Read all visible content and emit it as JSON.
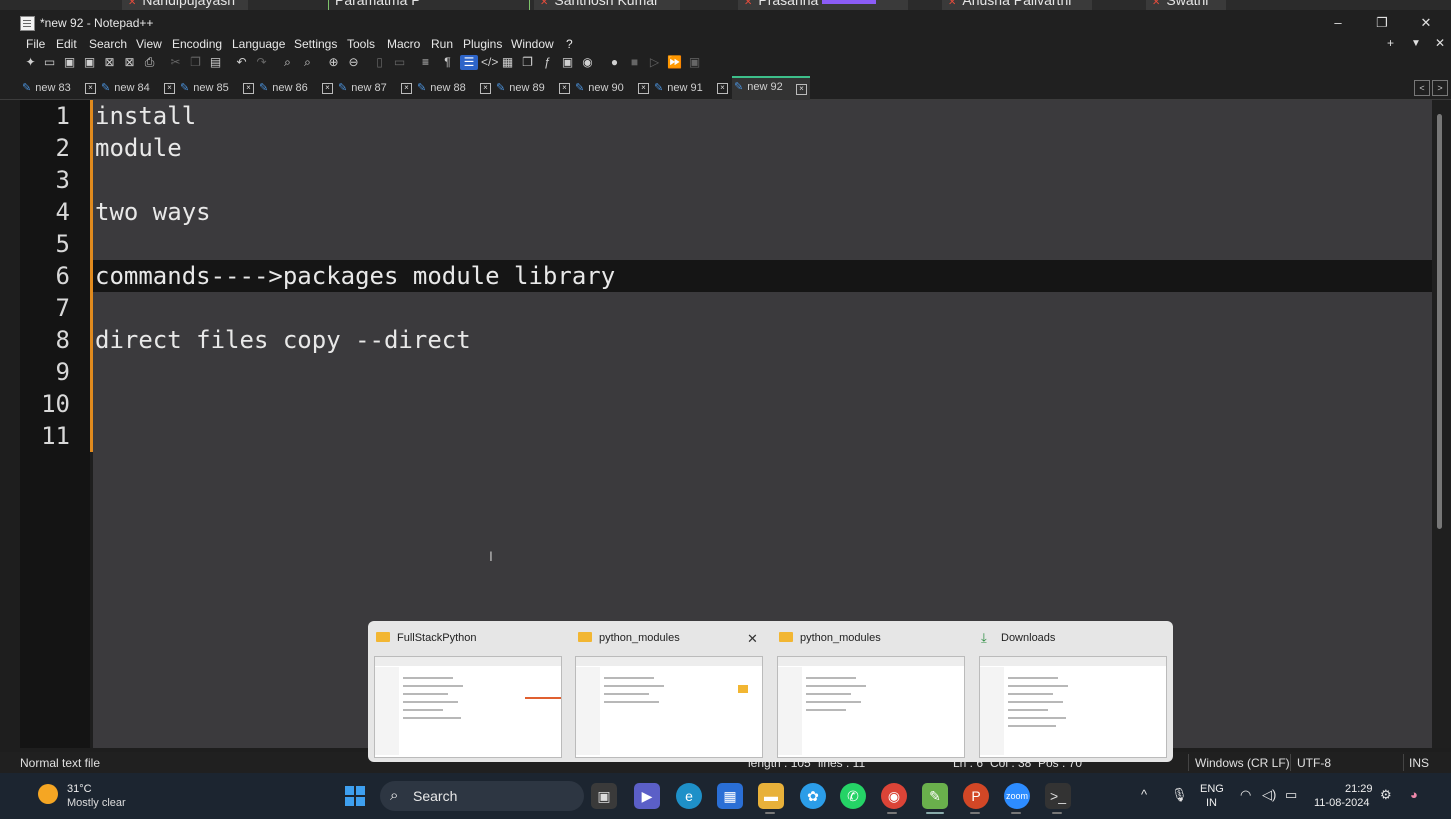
{
  "participants": [
    {
      "name": "Nandipujayash"
    },
    {
      "name": "Paramatma P"
    },
    {
      "name": "Santhosh Kumar"
    },
    {
      "name": "Prasanna"
    },
    {
      "name": "Anusha Pallvarthi"
    },
    {
      "name": "Swathi"
    }
  ],
  "window": {
    "title": "*new 92 - Notepad++",
    "minimize": "–",
    "restore": "❐",
    "close": "✕"
  },
  "menu": [
    "File",
    "Edit",
    "Search",
    "View",
    "Encoding",
    "Language",
    "Settings",
    "Tools",
    "Macro",
    "Run",
    "Plugins",
    "Window",
    "?"
  ],
  "menu_right": {
    "plus": "+",
    "dropdown": "▼",
    "close": "✕"
  },
  "toolbar_icons": [
    "new-file",
    "open-file",
    "save",
    "save-all",
    "close",
    "close-all",
    "print",
    "cut",
    "copy",
    "paste",
    "undo",
    "redo",
    "find",
    "replace",
    "zoom-in",
    "zoom-out",
    "sync-v",
    "sync-h",
    "word-wrap",
    "show-all-chars",
    "indent-guide",
    "udl",
    "doc-map",
    "doc-list",
    "function-list",
    "folder-workspace",
    "monitor",
    "record-macro",
    "stop-macro",
    "play-macro",
    "run-macro-multiple",
    "save-macro"
  ],
  "tabs": [
    {
      "label": "new 83",
      "active": false
    },
    {
      "label": "new 84",
      "active": false
    },
    {
      "label": "new 85",
      "active": false
    },
    {
      "label": "new 86",
      "active": false
    },
    {
      "label": "new 87",
      "active": false
    },
    {
      "label": "new 88",
      "active": false
    },
    {
      "label": "new 89",
      "active": false
    },
    {
      "label": "new 90",
      "active": false
    },
    {
      "label": "new 91",
      "active": false
    },
    {
      "label": "new 92",
      "active": true
    }
  ],
  "editor": {
    "lines": [
      {
        "num": "1",
        "text": "install"
      },
      {
        "num": "2",
        "text": "module"
      },
      {
        "num": "3",
        "text": ""
      },
      {
        "num": "4",
        "text": "two ways"
      },
      {
        "num": "5",
        "text": ""
      },
      {
        "num": "6",
        "text": "commands---->packages module library"
      },
      {
        "num": "7",
        "text": ""
      },
      {
        "num": "8",
        "text": "direct files copy --direct"
      },
      {
        "num": "9",
        "text": ""
      },
      {
        "num": "10",
        "text": ""
      },
      {
        "num": "11",
        "text": ""
      }
    ],
    "current_line": 6
  },
  "statusbar": {
    "file_type": "Normal text file",
    "length": "length : 105",
    "lines": "lines : 11",
    "ln": "Ln : 6",
    "col": "Col : 38",
    "pos": "Pos : 70",
    "eol": "Windows (CR LF)",
    "encoding": "UTF-8",
    "mode": "INS"
  },
  "thumbnails": [
    {
      "title": "FullStackPython",
      "icon": "folder-icon"
    },
    {
      "title": "python_modules",
      "icon": "folder-icon",
      "closable": true
    },
    {
      "title": "python_modules",
      "icon": "folder-icon"
    },
    {
      "title": "Downloads",
      "icon": "download-icon"
    }
  ],
  "taskbar": {
    "weather": {
      "temp": "31°C",
      "desc": "Mostly clear"
    },
    "search_label": "Search",
    "apps": [
      "start",
      "search",
      "task-view",
      "meet",
      "edge",
      "store",
      "file-explorer",
      "copilot-app",
      "whatsapp",
      "chrome",
      "notepad-plus-plus",
      "powerpoint",
      "zoom",
      "terminal"
    ],
    "lang": {
      "line1": "ENG",
      "line2": "IN"
    },
    "clock": {
      "time": "21:29",
      "date": "11-08-2024"
    }
  },
  "colors": {
    "accent_tab": "#3dbf8a",
    "fold_margin": "#e08a1e",
    "editor_bg": "#3b3a3d",
    "current_line": "#151515"
  }
}
